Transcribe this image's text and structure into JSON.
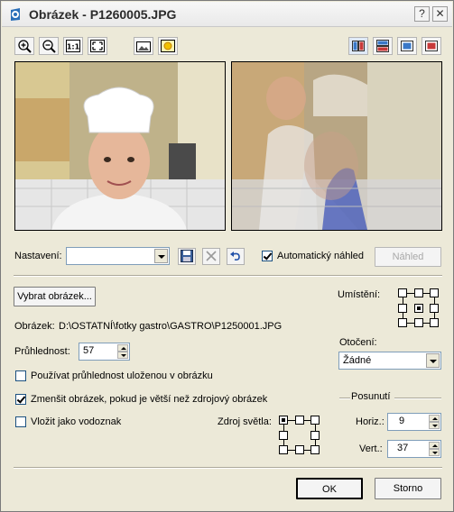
{
  "window": {
    "title": "Obrázek - P1260005.JPG",
    "help_label": "?",
    "close_label": "✕"
  },
  "toolbar": {
    "left_icons": [
      "zoom-in-icon",
      "zoom-out-icon",
      "actual-size-icon",
      "fit-to-window-icon",
      "image-icon",
      "brightness-icon"
    ],
    "actual_size_label": "1:1",
    "right_icons": [
      "side-by-side-view-icon",
      "top-bottom-view-icon",
      "source-only-view-icon",
      "result-only-view-icon"
    ]
  },
  "settings": {
    "label": "Nastavení:",
    "value": "",
    "save_icon": "save-icon",
    "delete_icon": "delete-icon",
    "undo_icon": "undo-icon",
    "auto_preview_label": "Automatický náhled",
    "auto_preview_checked": true,
    "preview_button": "Náhled"
  },
  "image": {
    "choose_button": "Vybrat obrázek...",
    "path_label": "Obrázek:",
    "path_value": "D:\\OSTATNÍ\\fotky gastro\\GASTRO\\P1250001.JPG"
  },
  "transparency": {
    "label": "Průhlednost:",
    "value": "57"
  },
  "options": {
    "use_saved_transparency": {
      "label": "Používat průhlednost uloženou v obrázku",
      "checked": false
    },
    "shrink_image": {
      "label": "Zmenšit obrázek, pokud je větší než zdrojový obrázek",
      "checked": true
    },
    "insert_watermark": {
      "label": "Vložit jako vodoznak",
      "checked": false
    }
  },
  "light_source": {
    "label": "Zdroj světla:"
  },
  "placement": {
    "label": "Umístění:"
  },
  "rotation": {
    "label": "Otočení:",
    "value": "Žádné"
  },
  "offset": {
    "group_label": "Posunutí",
    "horiz_label": "Horiz.:",
    "horiz_value": "9",
    "vert_label": "Vert.:",
    "vert_value": "37"
  },
  "footer": {
    "ok_label": "OK",
    "cancel_label": "Storno"
  },
  "colors": {
    "window_bg": "#ece9d8",
    "field_border": "#7f9db9",
    "active_view_bg": "#dfe9f7"
  }
}
